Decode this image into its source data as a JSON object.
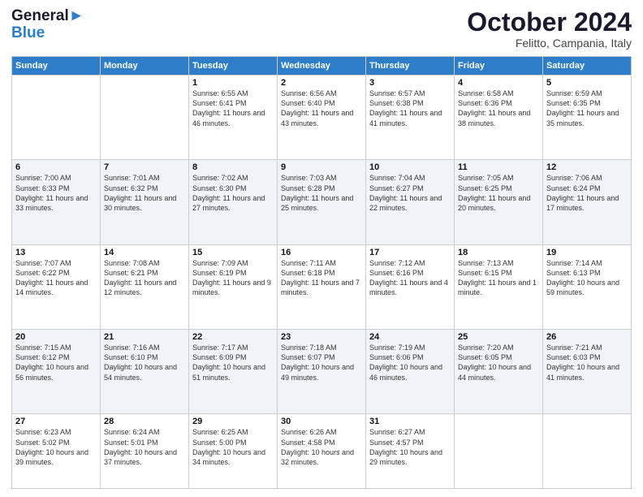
{
  "logo": {
    "line1": "General",
    "line2": "Blue"
  },
  "title": "October 2024",
  "location": "Felitto, Campania, Italy",
  "weekdays": [
    "Sunday",
    "Monday",
    "Tuesday",
    "Wednesday",
    "Thursday",
    "Friday",
    "Saturday"
  ],
  "weeks": [
    [
      {
        "day": "",
        "info": ""
      },
      {
        "day": "",
        "info": ""
      },
      {
        "day": "1",
        "info": "Sunrise: 6:55 AM\nSunset: 6:41 PM\nDaylight: 11 hours and 46 minutes."
      },
      {
        "day": "2",
        "info": "Sunrise: 6:56 AM\nSunset: 6:40 PM\nDaylight: 11 hours and 43 minutes."
      },
      {
        "day": "3",
        "info": "Sunrise: 6:57 AM\nSunset: 6:38 PM\nDaylight: 11 hours and 41 minutes."
      },
      {
        "day": "4",
        "info": "Sunrise: 6:58 AM\nSunset: 6:36 PM\nDaylight: 11 hours and 38 minutes."
      },
      {
        "day": "5",
        "info": "Sunrise: 6:59 AM\nSunset: 6:35 PM\nDaylight: 11 hours and 35 minutes."
      }
    ],
    [
      {
        "day": "6",
        "info": "Sunrise: 7:00 AM\nSunset: 6:33 PM\nDaylight: 11 hours and 33 minutes."
      },
      {
        "day": "7",
        "info": "Sunrise: 7:01 AM\nSunset: 6:32 PM\nDaylight: 11 hours and 30 minutes."
      },
      {
        "day": "8",
        "info": "Sunrise: 7:02 AM\nSunset: 6:30 PM\nDaylight: 11 hours and 27 minutes."
      },
      {
        "day": "9",
        "info": "Sunrise: 7:03 AM\nSunset: 6:28 PM\nDaylight: 11 hours and 25 minutes."
      },
      {
        "day": "10",
        "info": "Sunrise: 7:04 AM\nSunset: 6:27 PM\nDaylight: 11 hours and 22 minutes."
      },
      {
        "day": "11",
        "info": "Sunrise: 7:05 AM\nSunset: 6:25 PM\nDaylight: 11 hours and 20 minutes."
      },
      {
        "day": "12",
        "info": "Sunrise: 7:06 AM\nSunset: 6:24 PM\nDaylight: 11 hours and 17 minutes."
      }
    ],
    [
      {
        "day": "13",
        "info": "Sunrise: 7:07 AM\nSunset: 6:22 PM\nDaylight: 11 hours and 14 minutes."
      },
      {
        "day": "14",
        "info": "Sunrise: 7:08 AM\nSunset: 6:21 PM\nDaylight: 11 hours and 12 minutes."
      },
      {
        "day": "15",
        "info": "Sunrise: 7:09 AM\nSunset: 6:19 PM\nDaylight: 11 hours and 9 minutes."
      },
      {
        "day": "16",
        "info": "Sunrise: 7:11 AM\nSunset: 6:18 PM\nDaylight: 11 hours and 7 minutes."
      },
      {
        "day": "17",
        "info": "Sunrise: 7:12 AM\nSunset: 6:16 PM\nDaylight: 11 hours and 4 minutes."
      },
      {
        "day": "18",
        "info": "Sunrise: 7:13 AM\nSunset: 6:15 PM\nDaylight: 11 hours and 1 minute."
      },
      {
        "day": "19",
        "info": "Sunrise: 7:14 AM\nSunset: 6:13 PM\nDaylight: 10 hours and 59 minutes."
      }
    ],
    [
      {
        "day": "20",
        "info": "Sunrise: 7:15 AM\nSunset: 6:12 PM\nDaylight: 10 hours and 56 minutes."
      },
      {
        "day": "21",
        "info": "Sunrise: 7:16 AM\nSunset: 6:10 PM\nDaylight: 10 hours and 54 minutes."
      },
      {
        "day": "22",
        "info": "Sunrise: 7:17 AM\nSunset: 6:09 PM\nDaylight: 10 hours and 51 minutes."
      },
      {
        "day": "23",
        "info": "Sunrise: 7:18 AM\nSunset: 6:07 PM\nDaylight: 10 hours and 49 minutes."
      },
      {
        "day": "24",
        "info": "Sunrise: 7:19 AM\nSunset: 6:06 PM\nDaylight: 10 hours and 46 minutes."
      },
      {
        "day": "25",
        "info": "Sunrise: 7:20 AM\nSunset: 6:05 PM\nDaylight: 10 hours and 44 minutes."
      },
      {
        "day": "26",
        "info": "Sunrise: 7:21 AM\nSunset: 6:03 PM\nDaylight: 10 hours and 41 minutes."
      }
    ],
    [
      {
        "day": "27",
        "info": "Sunrise: 6:23 AM\nSunset: 5:02 PM\nDaylight: 10 hours and 39 minutes."
      },
      {
        "day": "28",
        "info": "Sunrise: 6:24 AM\nSunset: 5:01 PM\nDaylight: 10 hours and 37 minutes."
      },
      {
        "day": "29",
        "info": "Sunrise: 6:25 AM\nSunset: 5:00 PM\nDaylight: 10 hours and 34 minutes."
      },
      {
        "day": "30",
        "info": "Sunrise: 6:26 AM\nSunset: 4:58 PM\nDaylight: 10 hours and 32 minutes."
      },
      {
        "day": "31",
        "info": "Sunrise: 6:27 AM\nSunset: 4:57 PM\nDaylight: 10 hours and 29 minutes."
      },
      {
        "day": "",
        "info": ""
      },
      {
        "day": "",
        "info": ""
      }
    ]
  ]
}
